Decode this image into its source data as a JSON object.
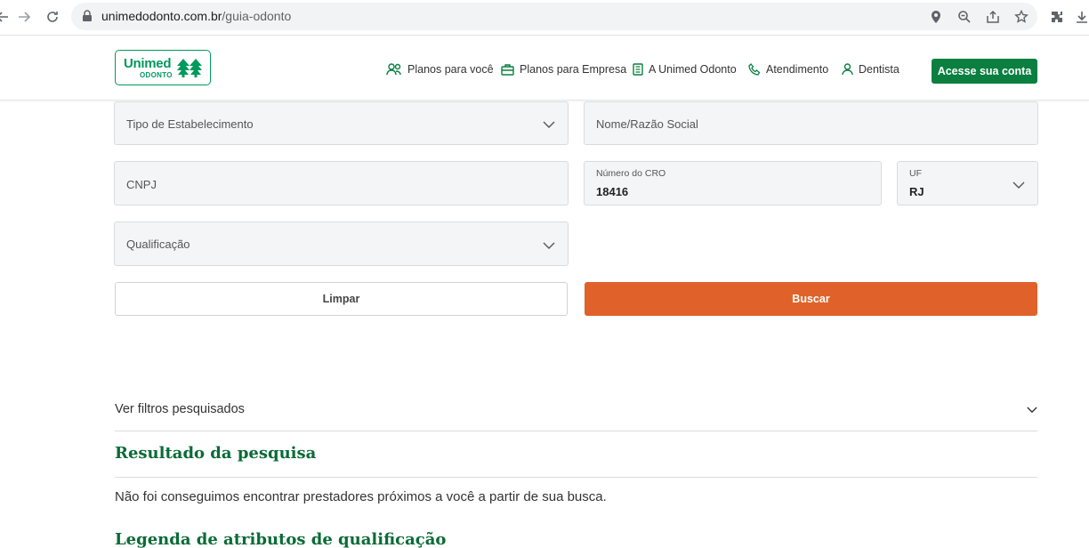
{
  "browser": {
    "url_host": "unimedodonto.com.br",
    "url_path": "/guia-odonto",
    "icons": [
      "back-icon",
      "forward-icon",
      "reload-icon",
      "lock-icon",
      "location-icon",
      "zoom-icon",
      "share-icon",
      "star-icon",
      "extensions-icon",
      "download-icon"
    ]
  },
  "header": {
    "logo_text": "Unimed",
    "logo_sub": "ODONTO",
    "nav": [
      {
        "label": "Planos para você",
        "icon": "people-icon"
      },
      {
        "label": "Planos para Empresa",
        "icon": "briefcase-icon"
      },
      {
        "label": "A Unimed Odonto",
        "icon": "book-icon"
      },
      {
        "label": "Atendimento",
        "icon": "phone-icon"
      },
      {
        "label": "Dentista",
        "icon": "user-icon"
      }
    ],
    "cta_label": "Acesse sua conta"
  },
  "form": {
    "tipo_placeholder": "Tipo de Estabelecimento",
    "nome_placeholder": "Nome/Razão Social",
    "cnpj_placeholder": "CNPJ",
    "cro_label": "Número do CRO",
    "cro_value": "18416",
    "uf_label": "UF",
    "uf_value": "RJ",
    "qualificacao_placeholder": "Qualificação",
    "clear_label": "Limpar",
    "search_label": "Buscar"
  },
  "results": {
    "filters_label": "Ver filtros pesquisados",
    "title": "Resultado da pesquisa",
    "message": "Não foi conseguimos encontrar prestadores próximos a você a partir de sua busca.",
    "legend_title": "Legenda de atributos de qualificação"
  },
  "colors": {
    "brand_green": "#00995d",
    "cta_green": "#0a7f3f",
    "search_orange": "#e0622a",
    "title_green": "#0a6b37"
  }
}
